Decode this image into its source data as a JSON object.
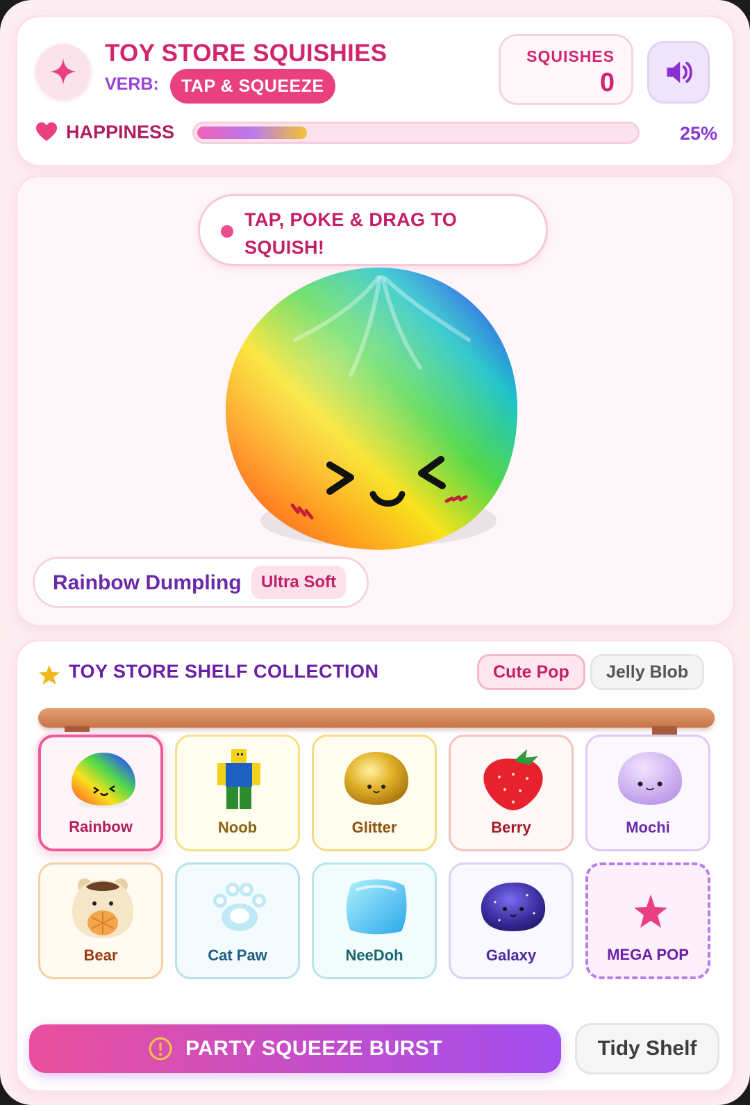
{
  "header": {
    "title": "TOY STORE SQUISHIES",
    "verb_label": "VERB:",
    "verb_value": "TAP & SQUEEZE",
    "counter_label": "SQUISHES",
    "counter_value": "0",
    "happiness_label": "HAPPINESS",
    "happiness_percent_text": "25%",
    "happiness_value": 0.25
  },
  "stage": {
    "hint": "TAP, POKE & DRAG TO SQUISH!",
    "current_name": "Rainbow Dumpling",
    "current_tag": "Ultra Soft"
  },
  "shelf": {
    "title": "TOY STORE SHELF COLLECTION",
    "themes": [
      {
        "label": "Cute Pop",
        "active": true
      },
      {
        "label": "Jelly Blob",
        "active": false
      }
    ],
    "items": [
      {
        "label": "Rainbow",
        "icon": "rainbow-dumpling-icon",
        "selected": true
      },
      {
        "label": "Noob",
        "icon": "noob-figure-icon"
      },
      {
        "label": "Glitter",
        "icon": "glitter-bun-icon"
      },
      {
        "label": "Berry",
        "icon": "strawberry-icon"
      },
      {
        "label": "Mochi",
        "icon": "mochi-icon"
      },
      {
        "label": "Bear",
        "icon": "bear-icon"
      },
      {
        "label": "Cat Paw",
        "icon": "cat-paw-icon"
      },
      {
        "label": "NeeDoh",
        "icon": "needoh-cube-icon"
      },
      {
        "label": "Galaxy",
        "icon": "galaxy-blob-icon"
      },
      {
        "label": "MEGA POP",
        "icon": "star-icon"
      }
    ]
  },
  "actions": {
    "burst_label": "PARTY SQUEEZE BURST",
    "tidy_label": "Tidy Shelf"
  },
  "colors": {
    "accent_pink": "#e9417f",
    "accent_purple": "#9a3fd8",
    "background": "#fdeef2"
  }
}
